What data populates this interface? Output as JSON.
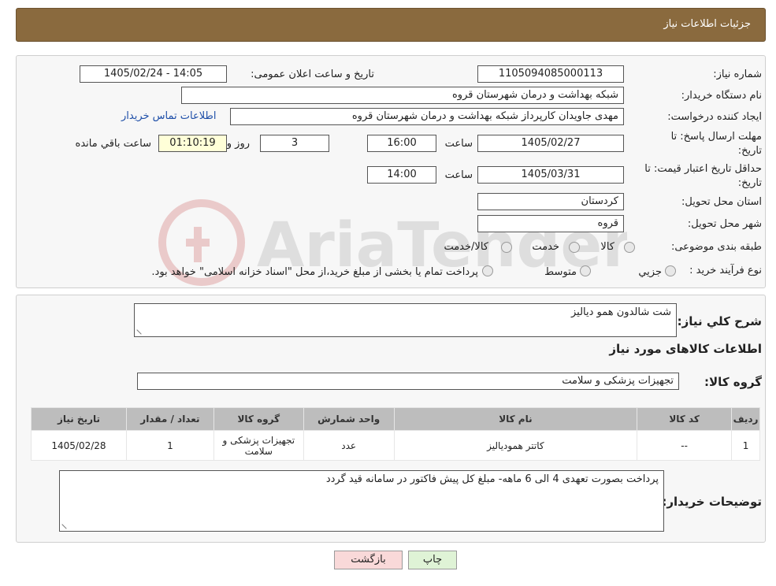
{
  "header": {
    "title": "جزئیات اطلاعات نیاز"
  },
  "details": {
    "need_number_label": "شماره نیاز:",
    "need_number": "1105094085000113",
    "announce_label": "تاریخ و ساعت اعلان عمومی:",
    "announce_value": "1405/02/24 - 14:05",
    "buyer_org_label": "نام دستگاه خریدار:",
    "buyer_org": "شبکه بهداشت و درمان شهرستان قروه",
    "creator_label": "ایجاد کننده درخواست:",
    "creator": "مهدی جاویدان کارپرداز شبکه بهداشت و درمان شهرستان قروه",
    "contact_link": "اطلاعات تماس خریدار",
    "deadline_label_1": "مهلت ارسال پاسخ: تا",
    "deadline_label_2": "تاریخ:",
    "deadline_date": "1405/02/27",
    "time_label": "ساعت",
    "deadline_time": "16:00",
    "days_value": "3",
    "days_label": "روز و",
    "remaining_time": "01:10:19",
    "remaining_label": "ساعت باقي مانده",
    "validity_label_1": "حداقل تاریخ اعتبار قیمت: تا",
    "validity_label_2": "تاریخ:",
    "validity_date": "1405/03/31",
    "validity_time_label": "ساعت",
    "validity_time": "14:00",
    "province_label": "استان محل تحویل:",
    "province": "کردستان",
    "city_label": "شهر محل تحویل:",
    "city": "قروه",
    "category_label": "طبقه بندی موضوعی:",
    "category_options": [
      "کالا",
      "خدمت",
      "کالا/خدمت"
    ],
    "process_label": "نوع فرآیند خرید :",
    "process_options": [
      "جزیي",
      "متوسط"
    ],
    "process_note": "پرداخت تمام یا بخشی از مبلغ خرید،از محل \"اسناد خزانه اسلامی\" خواهد بود."
  },
  "summary": {
    "desc_label": "شرح کلي نیاز:",
    "desc_value": "شت شالدون  همو دیالیز",
    "goods_info_title": "اطلاعات کالاهای مورد نیاز",
    "goods_group_label": "گروه کالا:",
    "goods_group_value": "تجهیزات پزشکی و سلامت"
  },
  "table": {
    "headers": [
      "ردیف",
      "کد کالا",
      "نام کالا",
      "واحد شمارش",
      "گروه کالا",
      "تعداد / مقدار",
      "تاریخ نیاز"
    ],
    "rows": [
      [
        "1",
        "--",
        "کاتتر همودیالیز",
        "عدد",
        "تجهیزات پزشکی و سلامت",
        "1",
        "1405/02/28"
      ]
    ]
  },
  "buyer_notes": {
    "label": "توضیحات خریدار:",
    "value": "پرداخت بصورت تعهدی 4 الی 6 ماهه- مبلغ کل پیش فاکتور در سامانه قید گردد"
  },
  "buttons": {
    "print": "چاپ",
    "back": "بازگشت"
  },
  "watermark": {
    "text": "AriaTender.neT"
  },
  "colors": {
    "header_bg": "#8a6a3e",
    "back_btn_bg": "#f9d9d9",
    "print_btn_bg": "#dff3d6"
  }
}
